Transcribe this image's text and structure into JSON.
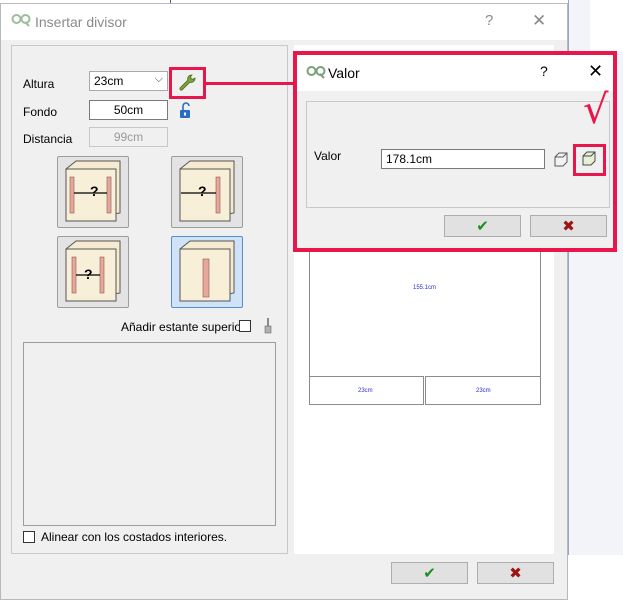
{
  "main_dialog": {
    "title": "Insertar divisor",
    "help_label": "?",
    "close_label": "✕",
    "altura": {
      "label": "Altura",
      "value": "23cm"
    },
    "fondo": {
      "label": "Fondo",
      "value": "50cm"
    },
    "distancia": {
      "label": "Distancia",
      "value": "99cm"
    },
    "tiles": [
      {
        "glyph": "?",
        "selected": false
      },
      {
        "glyph": "?",
        "selected": false
      },
      {
        "glyph": "?",
        "selected": false
      },
      {
        "glyph": "",
        "selected": true
      }
    ],
    "add_top_shelf_label": "Añadir estante superior",
    "align_label": "Alinear con los costados interiores.",
    "preview": {
      "center_label": "155.1cm",
      "left_label": "23cm",
      "right_label": "23cm"
    },
    "ok_glyph": "✔",
    "cancel_glyph": "✖"
  },
  "valor_dialog": {
    "title": "Valor",
    "help_label": "?",
    "close_label": "✕",
    "label": "Valor",
    "value": "178.1cm",
    "annotation_mark": "√",
    "ok_glyph": "✔",
    "cancel_glyph": "✖"
  },
  "colors": {
    "highlight": "#e8164a",
    "ok": "#1e8e1e",
    "cancel": "#9c1414",
    "tiny_text": "#2b2bd6"
  },
  "icons": [
    "qc-logo-icon",
    "wrench-icon",
    "padlock-open-icon",
    "brush-icon",
    "cube-outline-icon",
    "cube-fill-icon",
    "checkmark-icon",
    "x-mark-icon"
  ]
}
